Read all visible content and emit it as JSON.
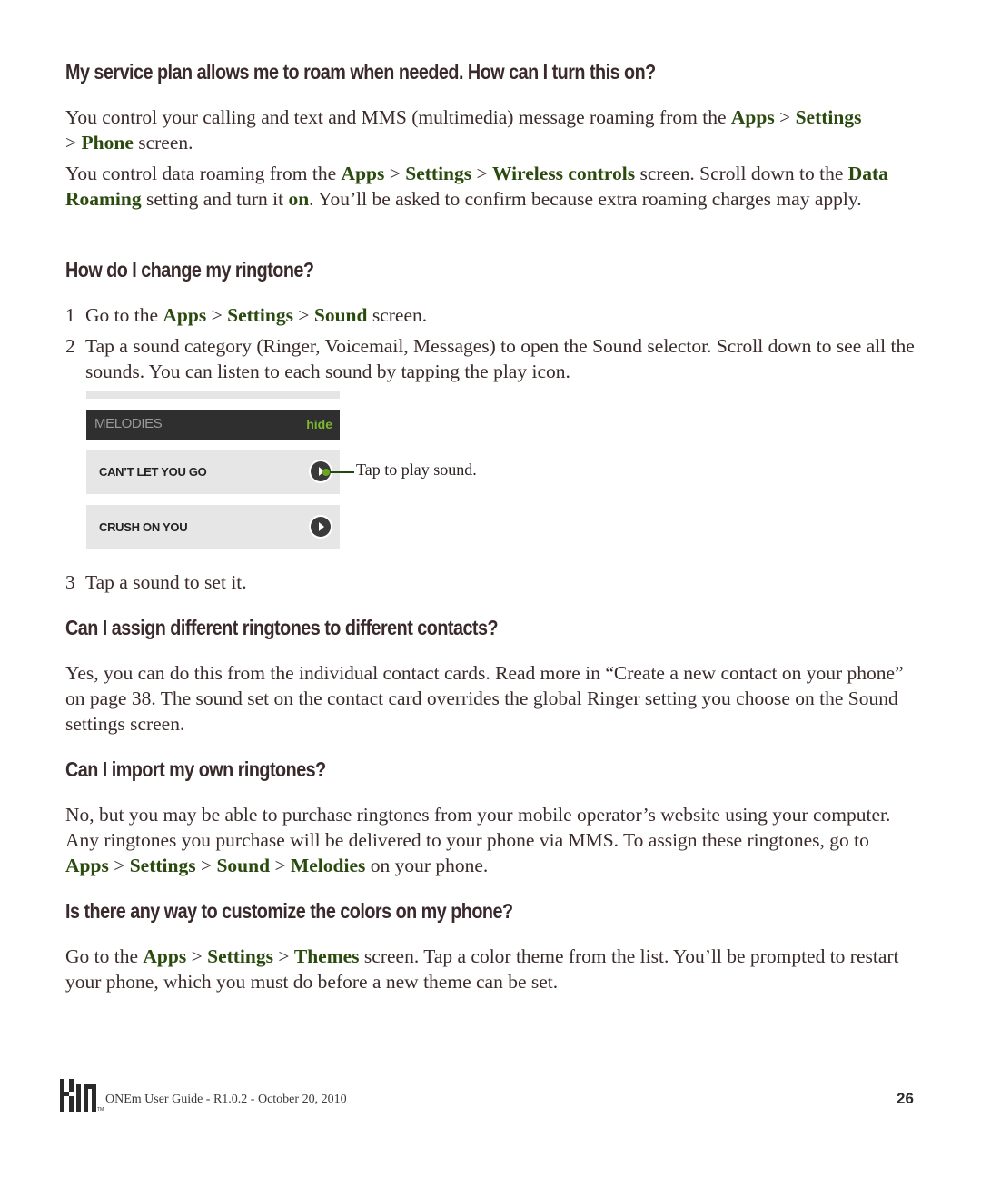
{
  "sections": [
    {
      "heading": "My service plan allows me to roam when needed. How can I turn this on?",
      "p1": {
        "a": "You control your calling and text and MMS (multimedia) message roaming from the ",
        "apps": "Apps",
        "sep1": " > ",
        "settings": "Settings",
        "sep2": " > ",
        "phone": "Phone",
        "end": " screen."
      },
      "p2": {
        "a": "You control data roaming from the ",
        "apps": "Apps",
        "sep1": " > ",
        "settings": "Settings",
        "sep2": " > ",
        "wireless": "Wireless controls",
        "b": " screen. Scroll down to the ",
        "data_roaming": "Data Roaming",
        "c": " setting and turn it ",
        "on": "on",
        "d": ". You’ll be asked to confirm because extra roaming charges may apply."
      }
    },
    {
      "heading": "How do I change my ringtone?",
      "steps": [
        {
          "num": "1",
          "a": "Go to the ",
          "apps": "Apps",
          "sep1": " > ",
          "settings": "Settings",
          "sep2": " > ",
          "sound": "Sound",
          "end": " screen."
        },
        {
          "num": "2",
          "text": "Tap a sound category (Ringer, Voicemail, Messages) to open the Sound selector. Scroll down to see all the sounds. You can listen to each sound by tapping the play icon."
        },
        {
          "num": "3",
          "text": "Tap a sound to set it."
        }
      ],
      "screenshot": {
        "header": "MELODIES",
        "hide": "hide",
        "items": [
          "CAN’T LET YOU GO",
          "CRUSH ON YOU"
        ],
        "callout": "Tap to play sound."
      }
    },
    {
      "heading": "Can I assign different ringtones to different contacts?",
      "text": "Yes, you can do this from the individual contact cards. Read more in “Create a new contact on your phone” on page 38. The sound set on the contact card overrides the global Ringer setting you choose on the Sound settings screen."
    },
    {
      "heading": "Can I import my own ringtones?",
      "a": "No, but you may be able to purchase ringtones from your mobile operator’s website using your computer. Any ringtones you purchase will be delivered to your phone via MMS. To assign these ringtones, go to ",
      "apps": "Apps",
      "sep1": " > ",
      "settings": "Settings",
      "sep2": " > ",
      "sound": "Sound",
      "sep3": " > ",
      "melodies": "Melodies",
      "end": " on your phone."
    },
    {
      "heading": "Is there any way to customize the colors on my phone?",
      "a": "Go to the ",
      "apps": "Apps",
      "sep1": " > ",
      "settings": "Settings",
      "sep2": " > ",
      "themes": "Themes",
      "end": " screen. Tap a color theme from the list. You’ll be prompted to restart your phone, which you must do before a new theme can be set."
    }
  ],
  "footer": {
    "logo": "KIN",
    "text": "ONEm User Guide - R1.0.2 - October 20, 2010",
    "page": "26"
  },
  "colors": {
    "link": "#2a4a0e",
    "heading": "#3a2a2c",
    "hide": "#7cb82f"
  }
}
